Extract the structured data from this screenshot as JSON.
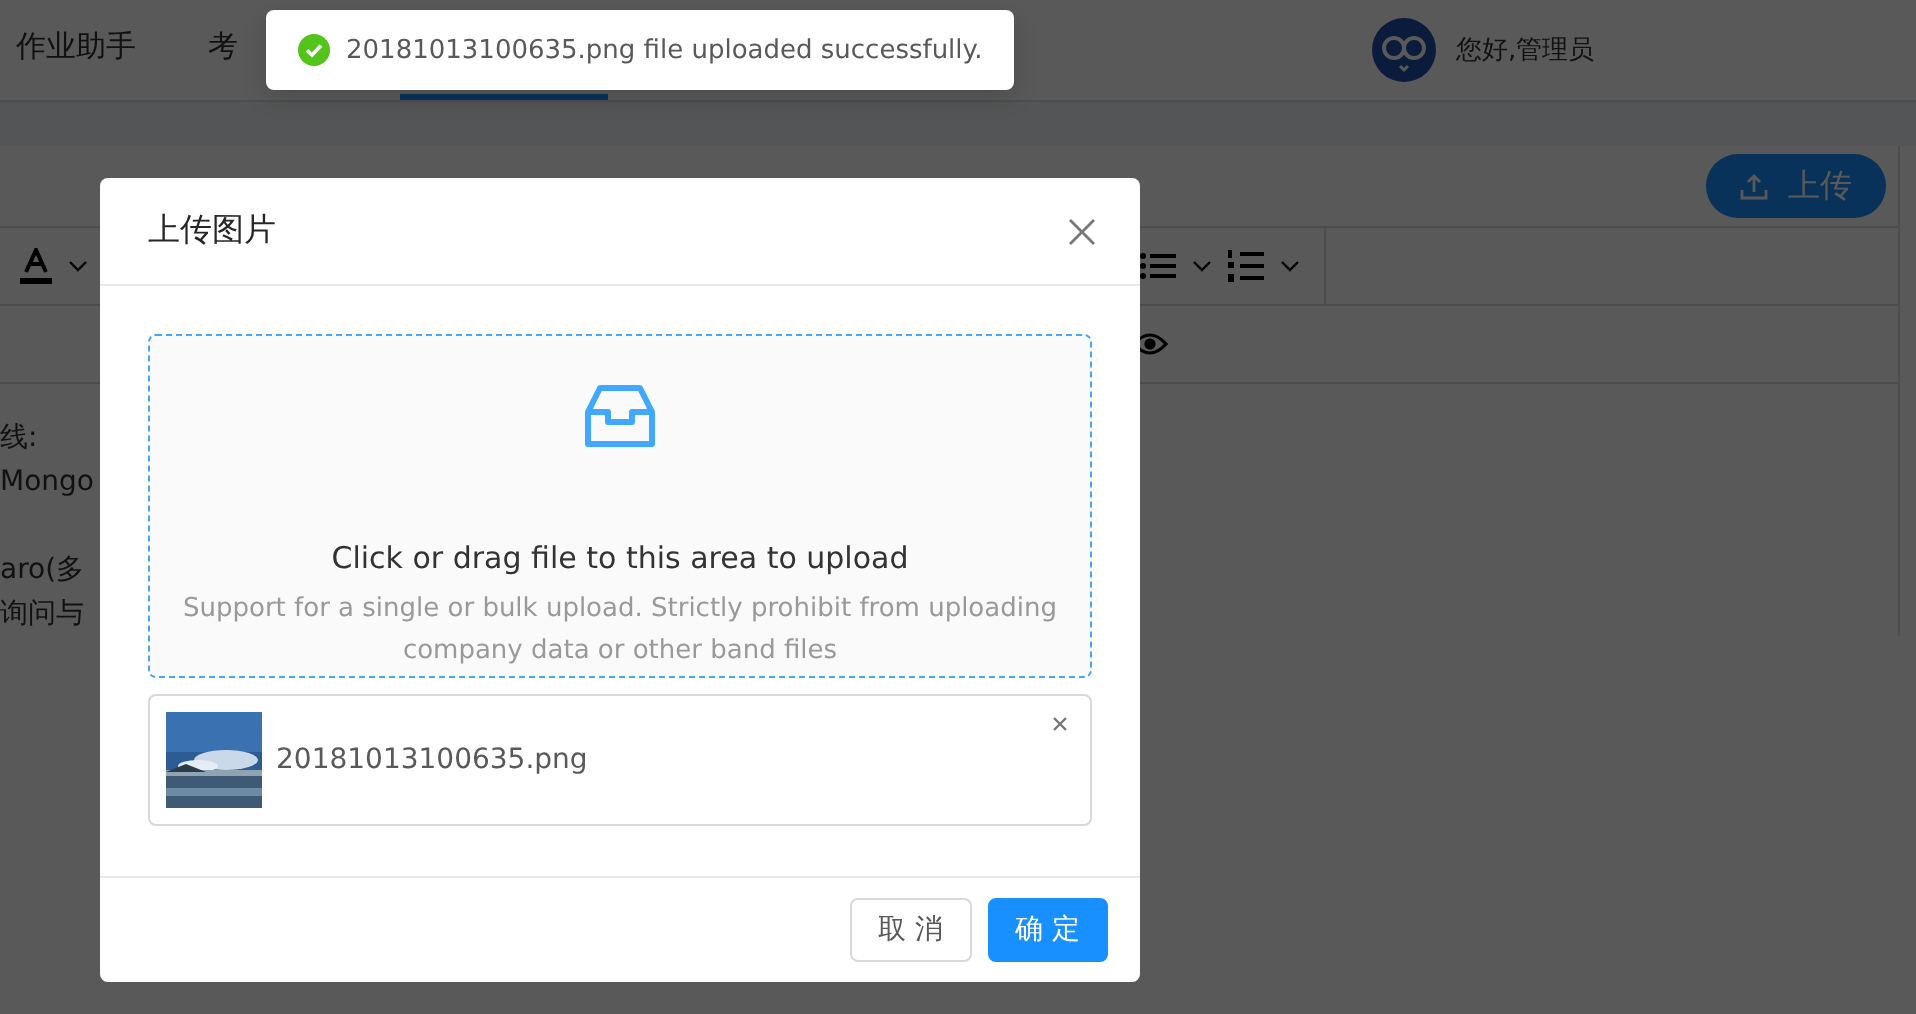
{
  "header": {
    "tabs": [
      {
        "label": "作业助手",
        "selected": false
      },
      {
        "label": "考",
        "selected": false
      },
      {
        "selected": true
      }
    ],
    "user": {
      "greeting": "您好,管理员"
    }
  },
  "upload_button": {
    "label": "上传"
  },
  "editor": {
    "paragraphs": [
      [
        "线:",
        "Mongo"
      ],
      [
        "aro(多",
        "询问与"
      ]
    ]
  },
  "modal": {
    "title": "上传图片",
    "dropzone": {
      "title": "Click or drag file to this area to upload",
      "hint": "Support for a single or bulk upload. Strictly prohibit from uploading company data or other band files"
    },
    "files": [
      {
        "name": "20181013100635.png"
      }
    ],
    "buttons": [
      {
        "label": "取 消",
        "primary": false
      },
      {
        "label": "确 定",
        "primary": true
      }
    ]
  },
  "toast": {
    "message": "20181013100635.png file uploaded successfully."
  }
}
